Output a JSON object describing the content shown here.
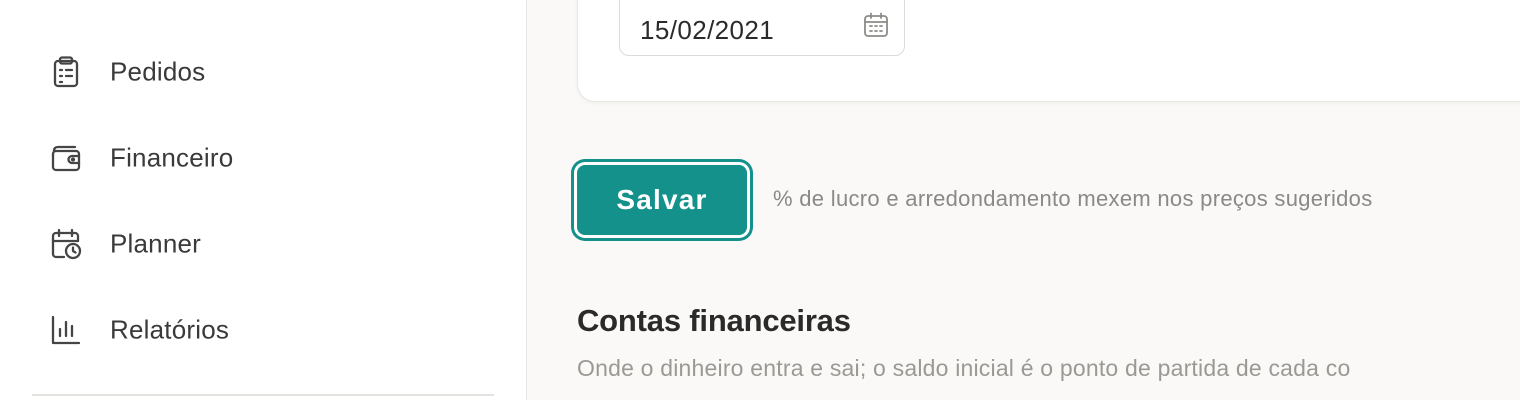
{
  "sidebar": {
    "items": [
      {
        "label": "Pedidos",
        "icon": "clipboard-icon"
      },
      {
        "label": "Financeiro",
        "icon": "wallet-icon"
      },
      {
        "label": "Planner",
        "icon": "calendar-clock-icon"
      },
      {
        "label": "Relatórios",
        "icon": "bar-chart-icon"
      }
    ]
  },
  "main": {
    "date_field": {
      "value": "15/02/2021",
      "icon": "calendar-icon"
    },
    "save_label": "Salvar",
    "save_hint": "% de lucro e arredondamento mexem nos preços sugeridos",
    "section": {
      "title": "Contas financeiras",
      "subtitle": "Onde o dinheiro entra e sai; o saldo inicial é o ponto de partida de cada co"
    }
  },
  "colors": {
    "accent": "#14918a",
    "text": "#3a3a3a",
    "muted": "#8a8985",
    "background": "#faf9f7"
  }
}
